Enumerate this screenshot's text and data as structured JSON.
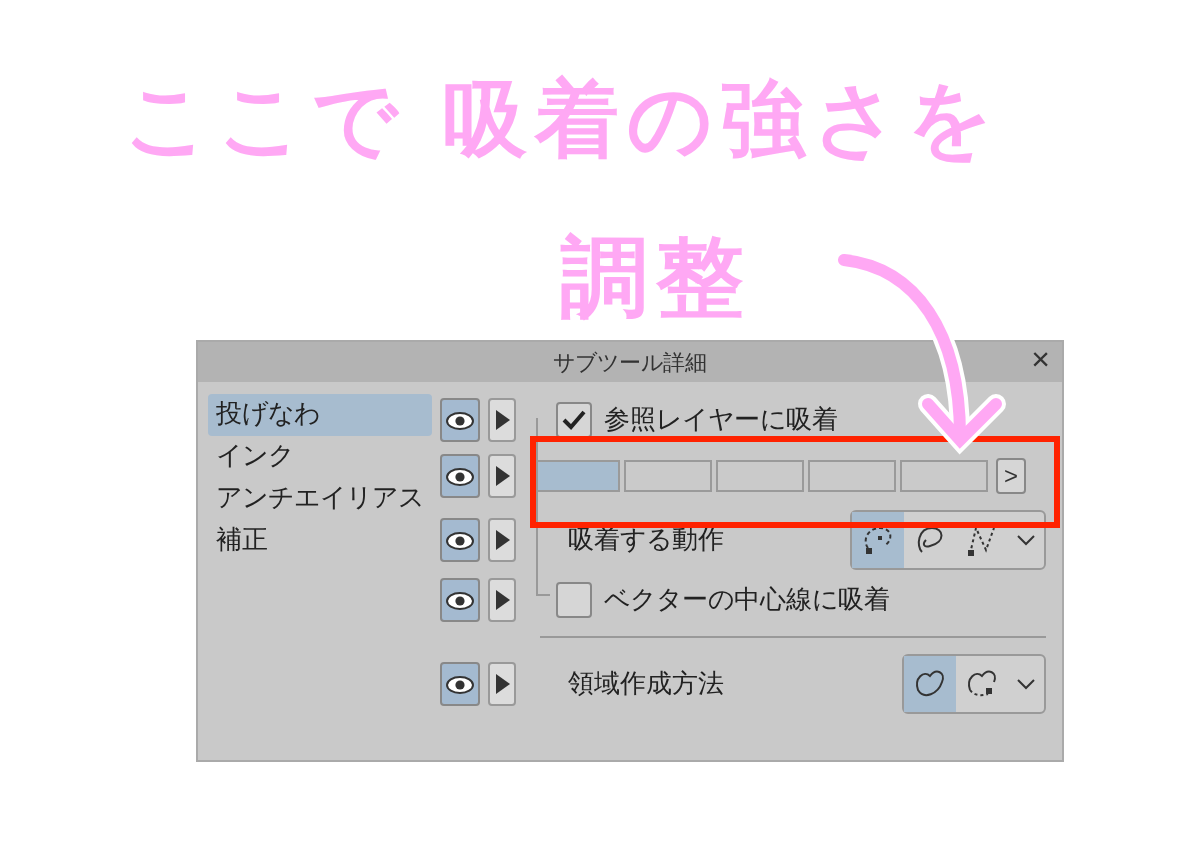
{
  "annotation": {
    "lines": [
      "ここで 吸着の強さを",
      "調整"
    ]
  },
  "dialog": {
    "title": "サブツール詳細",
    "close": "×"
  },
  "categories": [
    {
      "label": "投げなわ",
      "selected": true
    },
    {
      "label": "インク",
      "selected": false
    },
    {
      "label": "アンチエイリアス",
      "selected": false
    },
    {
      "label": "補正",
      "selected": false
    }
  ],
  "settings": [
    {
      "kind": "checkbox",
      "label": "参照レイヤーに吸着",
      "checked": true,
      "visible": true
    },
    {
      "kind": "segments",
      "level": 0.2,
      "visible": true,
      "next": ">"
    },
    {
      "kind": "choice",
      "label": "吸着する動作",
      "visible": true,
      "options": [
        {
          "kind": "magnet",
          "selected": true
        },
        {
          "kind": "loop",
          "selected": false
        },
        {
          "kind": "dots",
          "selected": false
        }
      ]
    },
    {
      "kind": "checkbox",
      "label": "ベクターの中心線に吸着",
      "checked": false,
      "visible": true
    }
  ],
  "method": {
    "label": "領域作成方法",
    "visible": true,
    "options": [
      {
        "kind": "blob",
        "selected": true
      },
      {
        "kind": "dashed",
        "selected": false
      }
    ]
  }
}
